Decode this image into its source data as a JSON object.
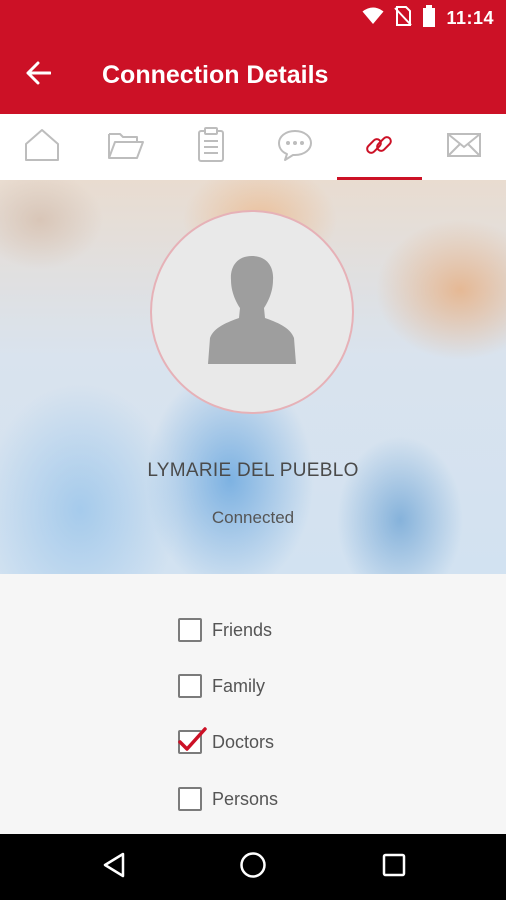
{
  "status_bar": {
    "time": "11:14",
    "icons": [
      "wifi-icon",
      "no-sim-icon",
      "battery-icon"
    ]
  },
  "app_bar": {
    "title": "Connection Details",
    "back_icon": "arrow-left-icon",
    "color": "#cc1126"
  },
  "tabs": [
    {
      "icon": "home-icon",
      "active": false
    },
    {
      "icon": "folder-icon",
      "active": false
    },
    {
      "icon": "clipboard-icon",
      "active": false
    },
    {
      "icon": "chat-icon",
      "active": false
    },
    {
      "icon": "link-icon",
      "active": true
    },
    {
      "icon": "mail-icon",
      "active": false
    }
  ],
  "profile": {
    "name": "LYMARIE DEL PUEBLO",
    "status": "Connected",
    "avatar_icon": "user-silhouette-icon"
  },
  "groups": [
    {
      "label": "Friends",
      "checked": false
    },
    {
      "label": "Family",
      "checked": false
    },
    {
      "label": "Doctors",
      "checked": true
    },
    {
      "label": "Persons",
      "checked": false
    }
  ],
  "nav_bar": {
    "buttons": [
      "back-triangle-icon",
      "home-circle-icon",
      "recents-square-icon"
    ]
  }
}
